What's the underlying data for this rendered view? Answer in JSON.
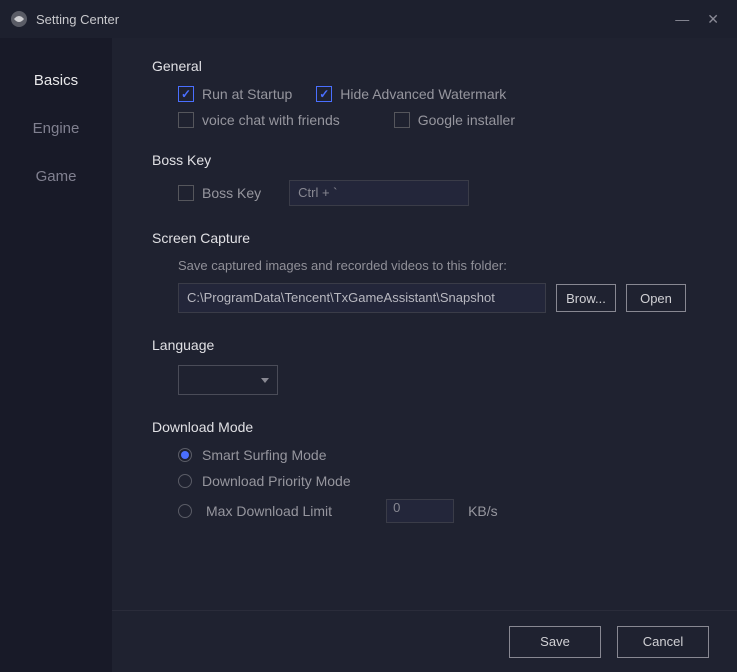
{
  "window": {
    "title": "Setting Center"
  },
  "sidebar": {
    "items": [
      {
        "label": "Basics",
        "active": true
      },
      {
        "label": "Engine",
        "active": false
      },
      {
        "label": "Game",
        "active": false
      }
    ]
  },
  "general": {
    "title": "General",
    "run_at_startup": {
      "label": "Run at Startup",
      "checked": true
    },
    "hide_watermark": {
      "label": "Hide Advanced Watermark",
      "checked": true
    },
    "voice_chat": {
      "label": "voice chat with friends",
      "checked": false
    },
    "google_installer": {
      "label": "Google installer",
      "checked": false
    }
  },
  "boss_key": {
    "title": "Boss Key",
    "checkbox": {
      "label": "Boss Key",
      "checked": false
    },
    "shortcut": "Ctrl + `"
  },
  "screen_capture": {
    "title": "Screen Capture",
    "hint": "Save captured images and recorded videos to this folder:",
    "path": "C:\\ProgramData\\Tencent\\TxGameAssistant\\Snapshot",
    "browse_label": "Brow...",
    "open_label": "Open"
  },
  "language": {
    "title": "Language",
    "value": ""
  },
  "download_mode": {
    "title": "Download Mode",
    "options": [
      {
        "label": "Smart Surfing Mode",
        "selected": true
      },
      {
        "label": "Download Priority Mode",
        "selected": false
      },
      {
        "label": "Max Download Limit",
        "selected": false
      }
    ],
    "limit_value": "0",
    "limit_unit": "KB/s"
  },
  "footer": {
    "save_label": "Save",
    "cancel_label": "Cancel"
  }
}
